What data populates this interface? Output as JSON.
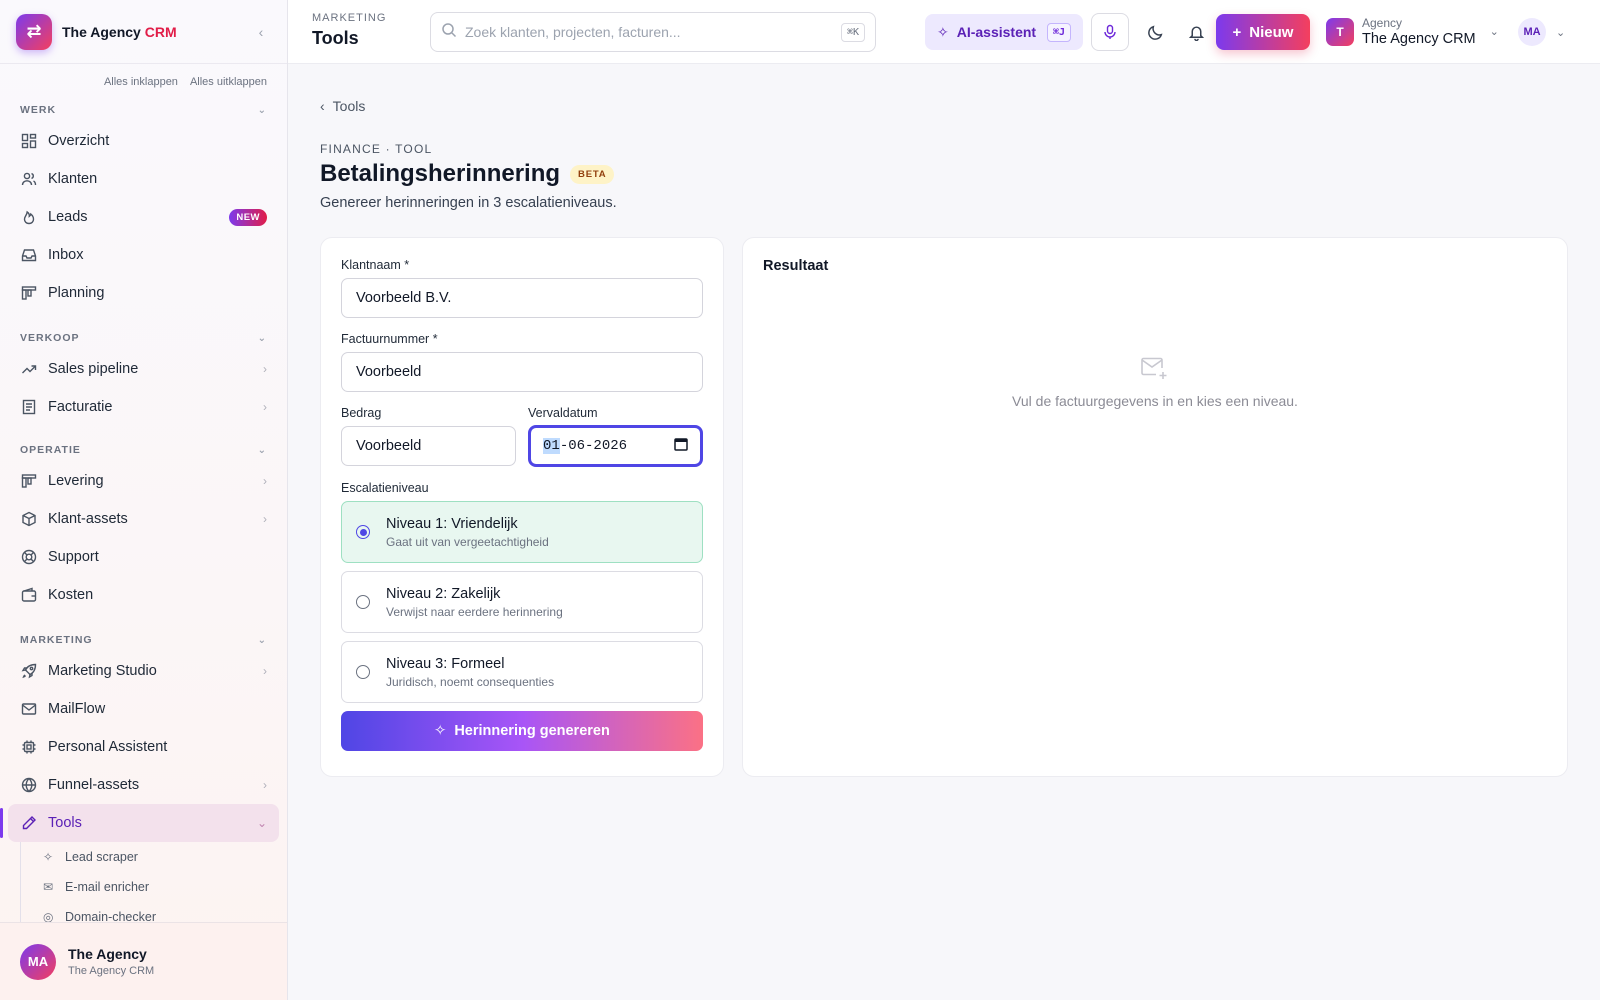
{
  "sidebar": {
    "brand_main": "The Agency ",
    "brand_accent": "CRM",
    "collapse_all": "Alles inklappen",
    "expand_all": "Alles uitklappen",
    "sections": {
      "werk": "WERK",
      "verkoop": "VERKOOP",
      "operatie": "OPERATIE",
      "marketing": "MARKETING"
    },
    "items": {
      "overzicht": "Overzicht",
      "klanten": "Klanten",
      "leads": "Leads",
      "leads_badge": "NEW",
      "inbox": "Inbox",
      "planning": "Planning",
      "sales_pipeline": "Sales pipeline",
      "facturatie": "Facturatie",
      "levering": "Levering",
      "klant_assets": "Klant-assets",
      "support": "Support",
      "kosten": "Kosten",
      "marketing_studio": "Marketing Studio",
      "mailflow": "MailFlow",
      "personal_assistent": "Personal Assistent",
      "funnel_assets": "Funnel-assets",
      "tools": "Tools"
    },
    "sub_items": {
      "lead_scraper": "Lead scraper",
      "email_enricher": "E-mail enricher",
      "domain_checker": "Domain-checker"
    },
    "footer": {
      "initials": "MA",
      "name": "The Agency",
      "sub": "The Agency CRM"
    }
  },
  "topbar": {
    "section": "MARKETING",
    "page": "Tools",
    "search_placeholder": "Zoek klanten, projecten, facturen...",
    "search_kbd": "⌘K",
    "ai_label": "AI-assistent",
    "ai_kbd": "⌘J",
    "new_label": "Nieuw",
    "org_initial": "T",
    "org_small": "Agency",
    "org_name": "The Agency CRM",
    "user_initials": "MA"
  },
  "main": {
    "back": "Tools",
    "eyebrow": "FINANCE · TOOL",
    "title": "Betalingsherinnering",
    "badge": "BETA",
    "description": "Genereer herinneringen in 3 escalatieniveaus."
  },
  "form": {
    "client_label": "Klantnaam *",
    "client_value": "Voorbeeld B.V.",
    "invoice_label": "Factuurnummer *",
    "invoice_value": "Voorbeeld",
    "amount_label": "Bedrag",
    "amount_value": "Voorbeeld",
    "due_label": "Vervaldatum",
    "due_day": "01",
    "due_rest": "-06-2026",
    "level_label": "Escalatieniveau",
    "levels": [
      {
        "title": "Niveau 1: Vriendelijk",
        "sub": "Gaat uit van vergeetachtigheid",
        "selected": true
      },
      {
        "title": "Niveau 2: Zakelijk",
        "sub": "Verwijst naar eerdere herinnering",
        "selected": false
      },
      {
        "title": "Niveau 3: Formeel",
        "sub": "Juridisch, noemt consequenties",
        "selected": false
      }
    ],
    "generate": "Herinnering genereren"
  },
  "result": {
    "title": "Resultaat",
    "empty_message": "Vul de factuurgegevens in en kies een niveau."
  },
  "colors": {
    "primary": "#4f46e5",
    "accent": "#e11d48",
    "selected_bg": "#e8f7f0"
  }
}
